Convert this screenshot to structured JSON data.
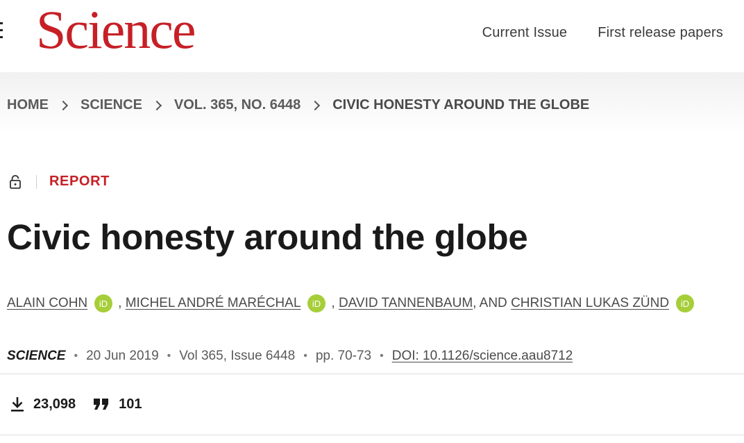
{
  "header": {
    "logo": "Science",
    "nav": [
      "Current Issue",
      "First release papers"
    ]
  },
  "breadcrumb": [
    "HOME",
    "SCIENCE",
    "VOL. 365, NO. 6448",
    "CIVIC HONESTY AROUND THE GLOBE"
  ],
  "article": {
    "type": "REPORT",
    "title": "Civic honesty around the globe",
    "authors": [
      "ALAIN COHN",
      "MICHEL ANDRÉ MARÉCHAL",
      "DAVID TANNENBAUM",
      "CHRISTIAN LUKAS ZÜND"
    ],
    "author_separators": [
      ",",
      ",",
      ", AND"
    ],
    "orcid_label": "iD",
    "journal": "SCIENCE",
    "date": "20 Jun 2019",
    "volume": "Vol 365, Issue 6448",
    "pages": "pp. 70-73",
    "doi": "DOI: 10.1126/science.aau8712",
    "meta_separator": "•"
  },
  "metrics": {
    "downloads": "23,098",
    "citations": "101"
  },
  "colors": {
    "brand": "#c62026",
    "orcid": "#a6ce39"
  },
  "icons": [
    "menu-icon",
    "lock-icon",
    "chevron-right-icon",
    "orcid-icon",
    "download-icon",
    "quote-icon"
  ]
}
